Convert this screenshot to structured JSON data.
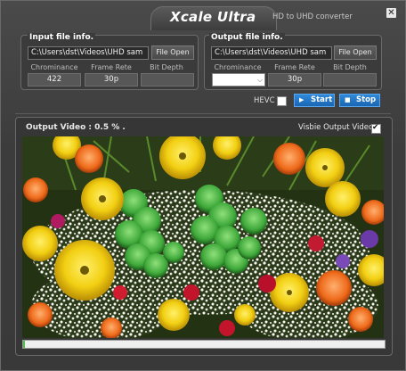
{
  "window": {
    "title": "Xcale Ultra",
    "subtitle": "HD to UHD converter",
    "close_icon": "close-icon"
  },
  "input": {
    "group_title": "Input file info.",
    "path": "C:\\Users\\dst\\Videos\\UHD sam",
    "file_open_label": "File Open",
    "chrominance_label": "Chrominance",
    "frame_rate_label": "Frame Rete",
    "bit_depth_label": "Bit Depth",
    "chrominance_value": "422",
    "frame_rate_value": "30p",
    "bit_depth_value": ""
  },
  "output": {
    "group_title": "Output file info.",
    "path": "C:\\Users\\dst\\Videos\\UHD sam",
    "file_open_label": "File Open",
    "chrominance_label": "Chrominance",
    "frame_rate_label": "Frame Rete",
    "bit_depth_label": "Bit Depth",
    "chrominance_value": "",
    "frame_rate_value": "30p",
    "bit_depth_value": ""
  },
  "controls": {
    "hevc_label": "HEVC",
    "hevc_checked": false,
    "start_label": "Start",
    "stop_label": "Stop"
  },
  "preview": {
    "output_video_label": "Output Video  : 0.5 % .",
    "visible_label": "Visbie Output Video",
    "visible_checked": true,
    "progress": 0.005
  },
  "colors": {
    "accent": "#1f74c6",
    "progress_fill": "#4fbf4f"
  }
}
